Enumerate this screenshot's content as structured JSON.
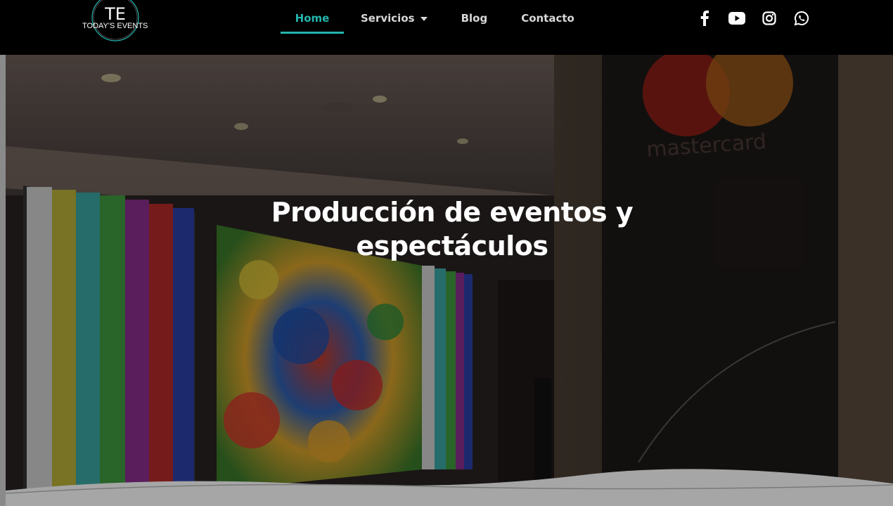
{
  "brand": {
    "logo_monogram": "TE",
    "logo_text": "TODAY'S EVENTS"
  },
  "nav": {
    "items": [
      {
        "label": "Home",
        "active": true
      },
      {
        "label": "Servicios",
        "active": false,
        "has_dropdown": true
      },
      {
        "label": "Blog",
        "active": false
      },
      {
        "label": "Contacto",
        "active": false
      }
    ]
  },
  "social": [
    "facebook-icon",
    "youtube-icon",
    "instagram-icon",
    "whatsapp-icon"
  ],
  "hero": {
    "title_line1": "Producción de eventos y",
    "title_line2": "espectáculos",
    "sign_text": "mastercard"
  },
  "colors": {
    "accent": "#23b5ad",
    "header_bg": "#000000",
    "nav_text": "#d7d7d7"
  }
}
